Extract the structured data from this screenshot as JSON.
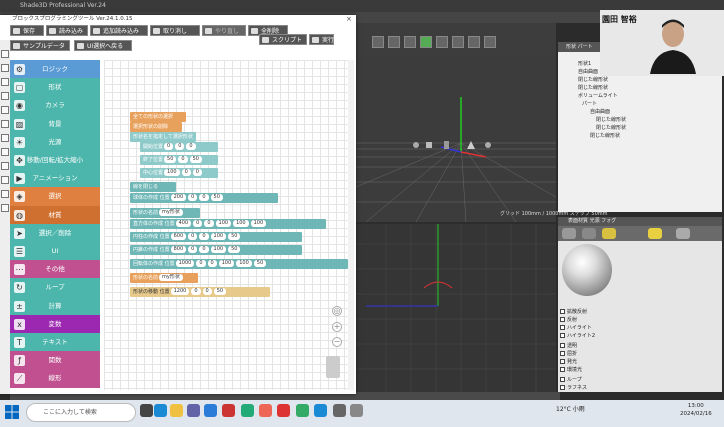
{
  "app": {
    "window_title": "Shade3D Professional Ver.24",
    "tree_tabs": "形状  パート",
    "tree_items": [
      "形状1",
      "自由曲面",
      "閉じた線形状",
      "閉じた線形状",
      "ボリュームライト",
      "パート",
      "自由曲面",
      "閉じた線形状",
      "閉じた線形状",
      "閉じた線形状"
    ],
    "viewport_info": "グリッド 100mm / 1000mm  ステップ 50mm",
    "material_header": "表面材質  光源  フォグ",
    "material_rows": [
      "拡散反射",
      "反射",
      "ハイライト",
      "ハイライト2",
      "透明",
      "屈折",
      "発光",
      "環境光",
      "ループ",
      "ラフネス"
    ],
    "webcam_name": "園田 智裕"
  },
  "editor": {
    "title": "ブロックスプログラミングツール Ver.24.1.0.15",
    "close": "×",
    "toolbar": [
      {
        "label": "保存",
        "name": "save-button"
      },
      {
        "label": "読み込み",
        "name": "load-button"
      },
      {
        "label": "追加読み込み",
        "name": "append-load-button"
      },
      {
        "label": "取り消し",
        "name": "undo-button"
      },
      {
        "label": "やり直し",
        "name": "redo-button"
      },
      {
        "label": "全削除",
        "name": "delete-all-button"
      },
      {
        "label": "スクリプト",
        "name": "script-button"
      },
      {
        "label": "実行",
        "name": "run-button"
      }
    ],
    "toolbar2": [
      {
        "label": "サンプルデータ",
        "name": "sample-data-button"
      },
      {
        "label": "UI選択へ戻る",
        "name": "back-to-ui-button"
      }
    ],
    "categories": [
      {
        "label": "ロジック",
        "color": "#5b9bd5",
        "icon": "⚙"
      },
      {
        "label": "形状",
        "color": "#4db6ac",
        "icon": "▢"
      },
      {
        "label": "カメラ",
        "color": "#4db6ac",
        "icon": "◉"
      },
      {
        "label": "背景",
        "color": "#4db6ac",
        "icon": "▨"
      },
      {
        "label": "光源",
        "color": "#4db6ac",
        "icon": "☀"
      },
      {
        "label": "移動/回転/拡大縮小",
        "color": "#4db6ac",
        "icon": "✥"
      },
      {
        "label": "アニメーション",
        "color": "#4db6ac",
        "icon": "▶"
      },
      {
        "label": "選択",
        "color": "#e08040",
        "icon": "◈"
      },
      {
        "label": "材質",
        "color": "#d07030",
        "icon": "◍"
      },
      {
        "label": "選択／削除",
        "color": "#4db6ac",
        "icon": "➤"
      },
      {
        "label": "UI",
        "color": "#4db6ac",
        "icon": "☰"
      },
      {
        "label": "その他",
        "color": "#c05090",
        "icon": "⋯"
      },
      {
        "label": "ループ",
        "color": "#4db6ac",
        "icon": "↻"
      },
      {
        "label": "計算",
        "color": "#4db6ac",
        "icon": "±"
      },
      {
        "label": "変数",
        "color": "#9c27b0",
        "icon": "x"
      },
      {
        "label": "テキスト",
        "color": "#4db6ac",
        "icon": "T"
      },
      {
        "label": "関数",
        "color": "#c05090",
        "icon": "ƒ"
      },
      {
        "label": "線形",
        "color": "#c05090",
        "icon": "⟋"
      }
    ],
    "blocks": [
      {
        "text": "全ての形状の選択",
        "style": "blk-o",
        "slots": []
      },
      {
        "text": "選択形状の削除",
        "style": "blk-o",
        "slots": []
      },
      {
        "text": "形状名を指定して選択形状",
        "style": "blk-tl",
        "slots": []
      },
      {
        "text": "開始位置",
        "style": "blk-tl",
        "slots": [
          "0",
          "0",
          "0"
        ]
      },
      {
        "text": "終了位置",
        "style": "blk-tl",
        "slots": [
          "50",
          "0",
          "50"
        ]
      },
      {
        "text": "中心位置",
        "style": "blk-tl",
        "slots": [
          "100",
          "0",
          "0"
        ]
      },
      {
        "text": "線を閉じる",
        "style": "blk-t",
        "slots": []
      },
      {
        "text": "球体の作成 位置",
        "style": "blk-t",
        "slots": [
          "200",
          "0",
          "0",
          "50"
        ]
      },
      {
        "text": "形状の名前",
        "style": "blk-t",
        "slots": [
          "my形状"
        ]
      },
      {
        "text": "直方体の作成 位置",
        "style": "blk-t",
        "slots": [
          "400",
          "0",
          "0",
          "100",
          "100",
          "100"
        ]
      },
      {
        "text": "円柱の作成 位置",
        "style": "blk-t",
        "slots": [
          "600",
          "0",
          "0",
          "100",
          "50"
        ]
      },
      {
        "text": "円錐の作成 位置",
        "style": "blk-t",
        "slots": [
          "800",
          "0",
          "0",
          "100",
          "50"
        ]
      },
      {
        "text": "回転体の作成 位置",
        "style": "blk-t",
        "slots": [
          "1000",
          "0",
          "0",
          "100",
          "100",
          "50"
        ]
      },
      {
        "text": "形状の名前",
        "style": "blk-o",
        "slots": [
          "my形状"
        ]
      },
      {
        "text": "形状の移動 位置",
        "style": "blk-y",
        "slots": [
          "1200",
          "0",
          "0",
          "50"
        ]
      }
    ]
  },
  "taskbar": {
    "search_placeholder": "ここに入力して検索",
    "weather": "12°C  小雨",
    "time": "13:00",
    "date": "2024/02/16"
  }
}
